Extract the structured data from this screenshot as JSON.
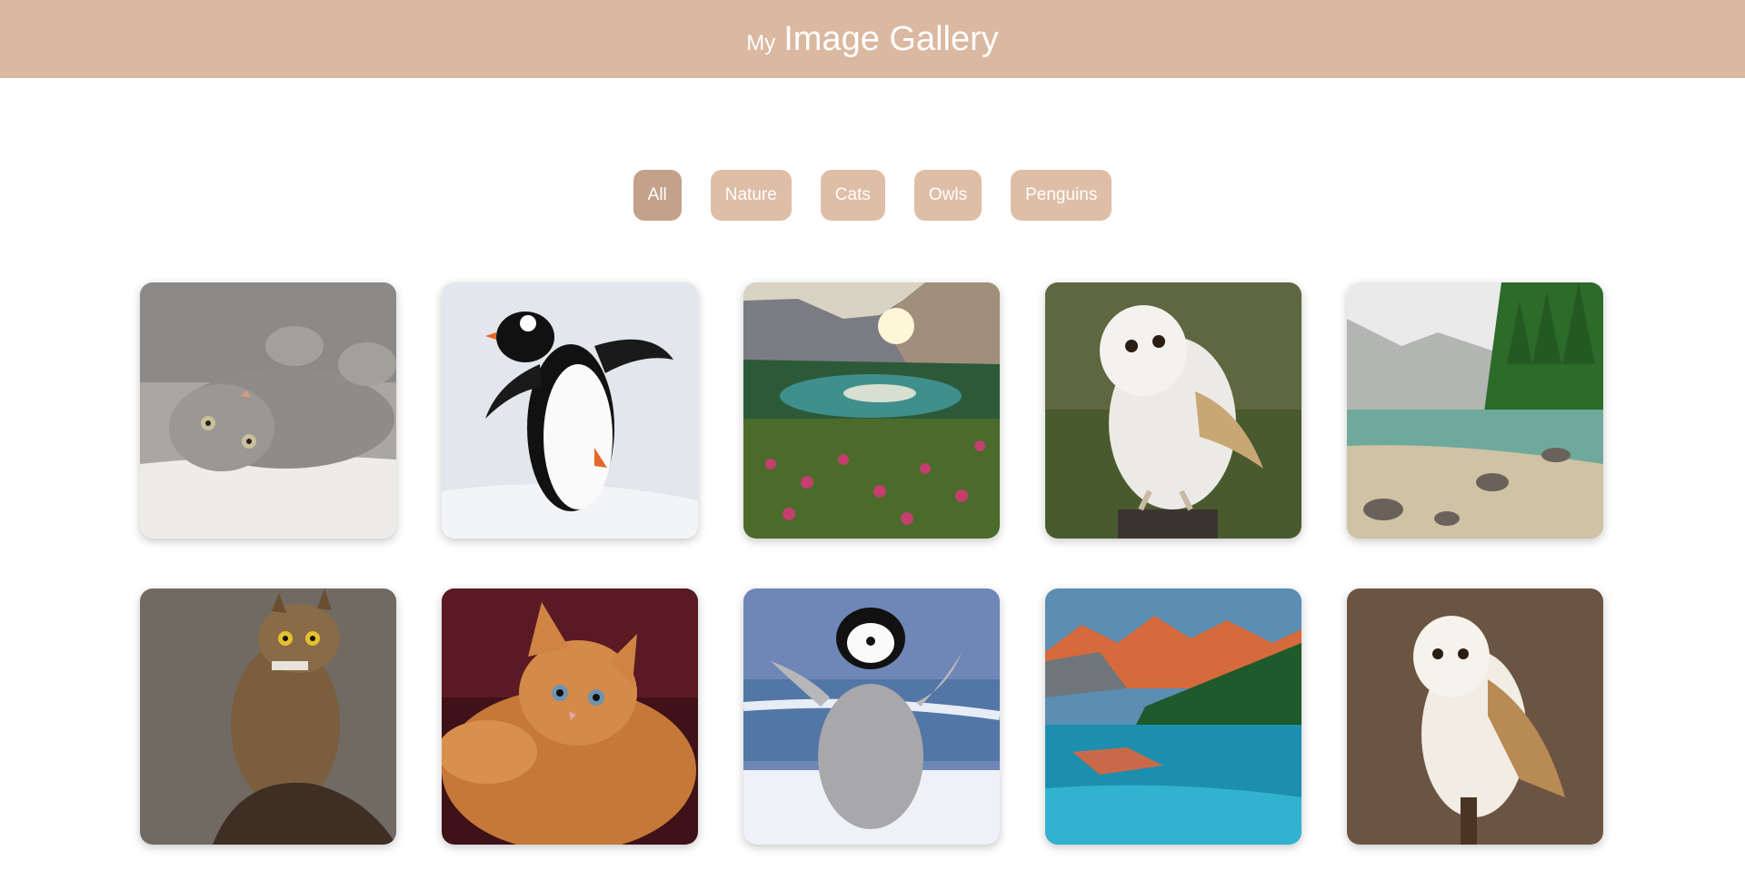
{
  "header": {
    "title_prefix": "My",
    "title_main": "Image Gallery",
    "background": "#dbb8a0"
  },
  "filters": [
    {
      "label": "All",
      "active": true
    },
    {
      "label": "Nature",
      "active": false
    },
    {
      "label": "Cats",
      "active": false
    },
    {
      "label": "Owls",
      "active": false
    },
    {
      "label": "Penguins",
      "active": false
    }
  ],
  "colors": {
    "filter": "#dfbea7",
    "filter_active": "#c3a18a"
  },
  "gallery": [
    {
      "subject": "cat-lying-on-back"
    },
    {
      "subject": "penguin-walking-on-snow"
    },
    {
      "subject": "mountain-lake-sunrise-flowers"
    },
    {
      "subject": "barn-owl-perched"
    },
    {
      "subject": "alpine-lake-forest"
    },
    {
      "subject": "horned-owl-on-rock"
    },
    {
      "subject": "orange-kitten"
    },
    {
      "subject": "penguin-chick"
    },
    {
      "subject": "turquoise-lake-red-mountains"
    },
    {
      "subject": "barn-owl-on-branch"
    }
  ]
}
